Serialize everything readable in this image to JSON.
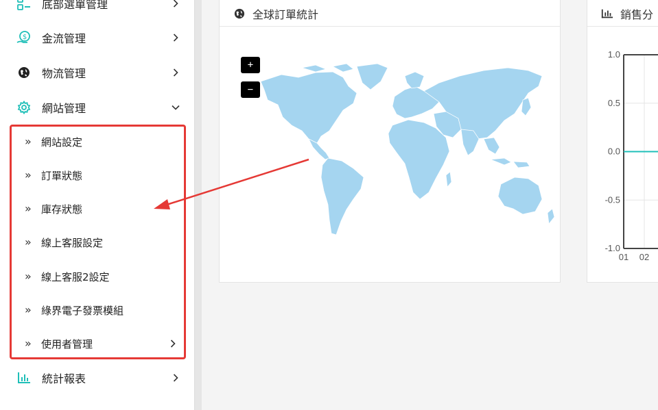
{
  "sidebar": {
    "items": [
      {
        "label": "底部選單管理",
        "icon": "list-icon"
      },
      {
        "label": "金流管理",
        "icon": "money-icon"
      },
      {
        "label": "物流管理",
        "icon": "globe-icon"
      },
      {
        "label": "網站管理",
        "icon": "gear-icon"
      },
      {
        "label": "統計報表",
        "icon": "bar-chart-icon"
      }
    ],
    "sub_items": [
      {
        "label": "網站設定"
      },
      {
        "label": "訂單狀態"
      },
      {
        "label": "庫存狀態"
      },
      {
        "label": "線上客服設定"
      },
      {
        "label": "線上客服2設定"
      },
      {
        "label": "綠界電子發票模組"
      },
      {
        "label": "使用者管理"
      }
    ],
    "sub_marker": "»"
  },
  "map_panel": {
    "title": "全球訂單統計",
    "zoom_in": "+",
    "zoom_out": "−"
  },
  "sales_panel": {
    "title": "銷售分"
  },
  "chart_data": {
    "type": "line",
    "x": [
      "01",
      "02"
    ],
    "series": [
      {
        "values": [
          0,
          0
        ]
      }
    ],
    "y_ticks": [
      "1.0",
      "0.5",
      "0.0",
      "-0.5",
      "-1.0"
    ],
    "ylim": [
      -1.0,
      1.0
    ],
    "grid": true
  },
  "colors": {
    "accent": "#1fbfb8",
    "annotation_red": "#e53935",
    "map_land": "#a5d5f0"
  }
}
